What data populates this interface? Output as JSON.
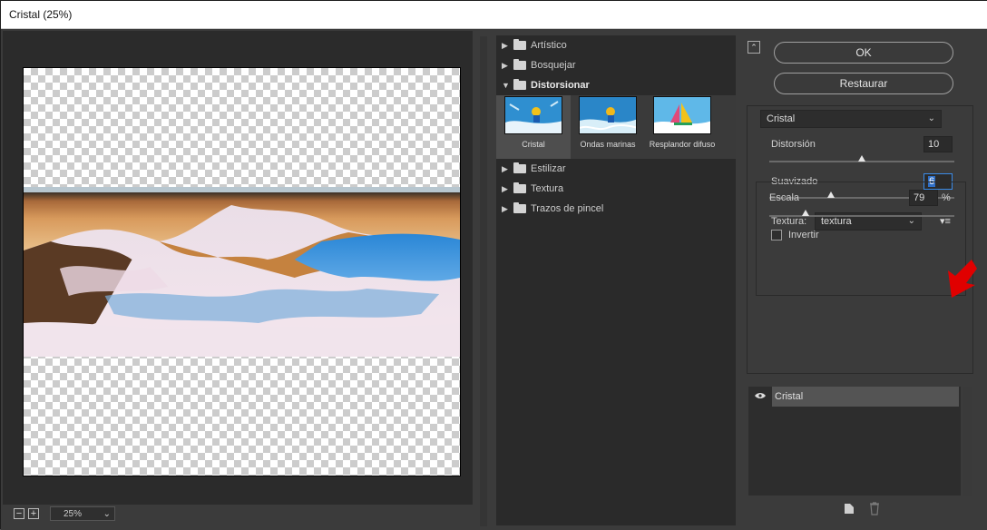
{
  "window": {
    "title": "Cristal (25%)"
  },
  "preview": {
    "zoom": "25%",
    "zoom_out": "−",
    "zoom_in": "+"
  },
  "filter_gallery": {
    "categories": [
      {
        "label": "Artístico",
        "expanded": false
      },
      {
        "label": "Bosquejar",
        "expanded": false
      },
      {
        "label": "Distorsionar",
        "expanded": true,
        "filters": [
          {
            "label": "Cristal",
            "selected": true
          },
          {
            "label": "Ondas marinas",
            "selected": false
          },
          {
            "label": "Resplandor difuso",
            "selected": false
          }
        ]
      },
      {
        "label": "Estilizar",
        "expanded": false
      },
      {
        "label": "Textura",
        "expanded": false
      },
      {
        "label": "Trazos de pincel",
        "expanded": false
      }
    ]
  },
  "settings": {
    "ok_label": "OK",
    "reset_label": "Restaurar",
    "filter_select": "Cristal",
    "distortion": {
      "label": "Distorsión",
      "value": "10",
      "level": 0.5
    },
    "smoothness": {
      "label": "Suavizado",
      "value": "6",
      "level": 0.33
    },
    "texture": {
      "label": "Textura:",
      "value": "textura"
    },
    "scale": {
      "label": "Escala",
      "value": "79",
      "unit": "%",
      "level": 0.2
    },
    "invert": {
      "label": "Invertir",
      "checked": false
    }
  },
  "layers": {
    "items": [
      {
        "name": "Cristal",
        "visible": true
      }
    ]
  }
}
